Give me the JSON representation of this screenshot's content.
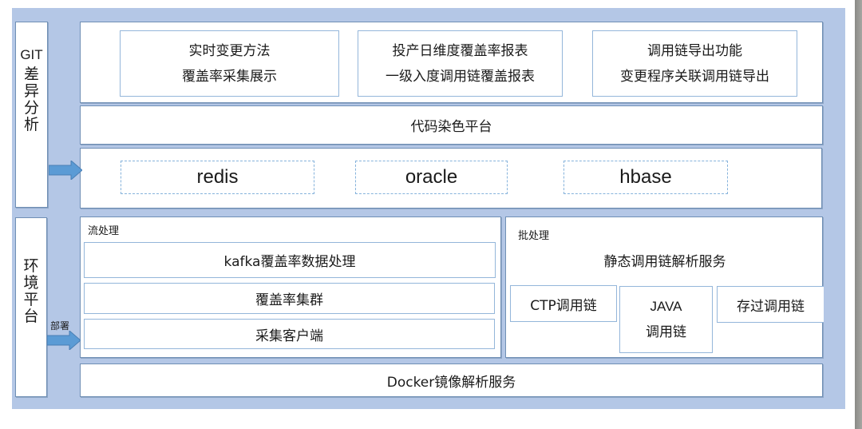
{
  "diagram": {
    "left_labels": {
      "git": {
        "latin": "GIT",
        "chars": [
          "差",
          "异",
          "分",
          "析"
        ]
      },
      "env": {
        "chars": [
          "环",
          "境",
          "平",
          "台"
        ]
      }
    },
    "top_features": [
      {
        "line1": "实时变更方法",
        "line2": "覆盖率采集展示"
      },
      {
        "line1": "投产日维度覆盖率报表",
        "line2": "一级入度调用链覆盖报表"
      },
      {
        "line1": "调用链导出功能",
        "line2": "变更程序关联调用链导出"
      }
    ],
    "platform": "代码染色平台",
    "storage": [
      "redis",
      "oracle",
      "hbase"
    ],
    "stream": {
      "title": "流处理",
      "items": [
        "kafka覆盖率数据处理",
        "覆盖率集群",
        "采集客户端"
      ]
    },
    "batch": {
      "title": "批处理",
      "service": "静态调用链解析服务",
      "chains": {
        "ctp": "CTP调用链",
        "java_line1": "JAVA",
        "java_line2": "调用链",
        "proc": "存过调用链"
      }
    },
    "deploy_label": "部署",
    "docker": "Docker镜像解析服务",
    "colors": {
      "background_panel": "#b4c7e6",
      "box_border": "#6f8fb5",
      "arrow_fill": "#5b9bd5",
      "dashed_border": "#86b3dc"
    }
  }
}
